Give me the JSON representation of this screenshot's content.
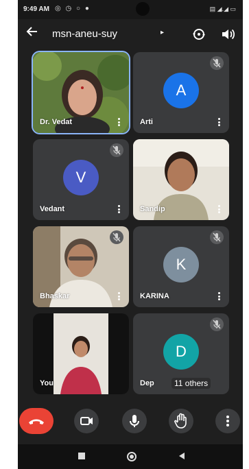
{
  "status_bar": {
    "time": "9:49 AM",
    "left_icons": "◎ ◷ ○ ●",
    "right_icons": "▤ ◢.◢ ▭"
  },
  "header": {
    "title": "msn-aneu-suy",
    "chevron": "▸"
  },
  "participants": [
    {
      "name": "Dr. Vedat",
      "avatar_letter": "",
      "video_on": true,
      "muted": false,
      "active_speaker": true
    },
    {
      "name": "Arti",
      "avatar_letter": "A",
      "avatar_color": "#1a73e8",
      "video_on": false,
      "muted": true
    },
    {
      "name": "Vedant",
      "avatar_letter": "V",
      "avatar_color": "#4a5bc4",
      "video_on": false,
      "muted": true
    },
    {
      "name": "Sandip",
      "avatar_letter": "",
      "video_on": true,
      "muted": false
    },
    {
      "name": "Bhaskar",
      "avatar_letter": "",
      "video_on": true,
      "muted": true
    },
    {
      "name": "KARINA",
      "avatar_letter": "K",
      "avatar_color": "#7e8f9e",
      "video_on": false,
      "muted": true
    },
    {
      "name": "You",
      "avatar_letter": "",
      "video_on": true,
      "muted": false
    },
    {
      "name": "Dep",
      "avatar_letter": "D",
      "avatar_color": "#12a4a6",
      "video_on": false,
      "muted": true
    }
  ],
  "others_label": "11 others",
  "colors": {
    "background": "#1f1f1f",
    "tile": "#3a3b3d",
    "end_call": "#ea4335",
    "active_border": "#8ab4f8"
  },
  "controls": [
    "end-call",
    "camera",
    "microphone",
    "raise-hand",
    "more"
  ]
}
